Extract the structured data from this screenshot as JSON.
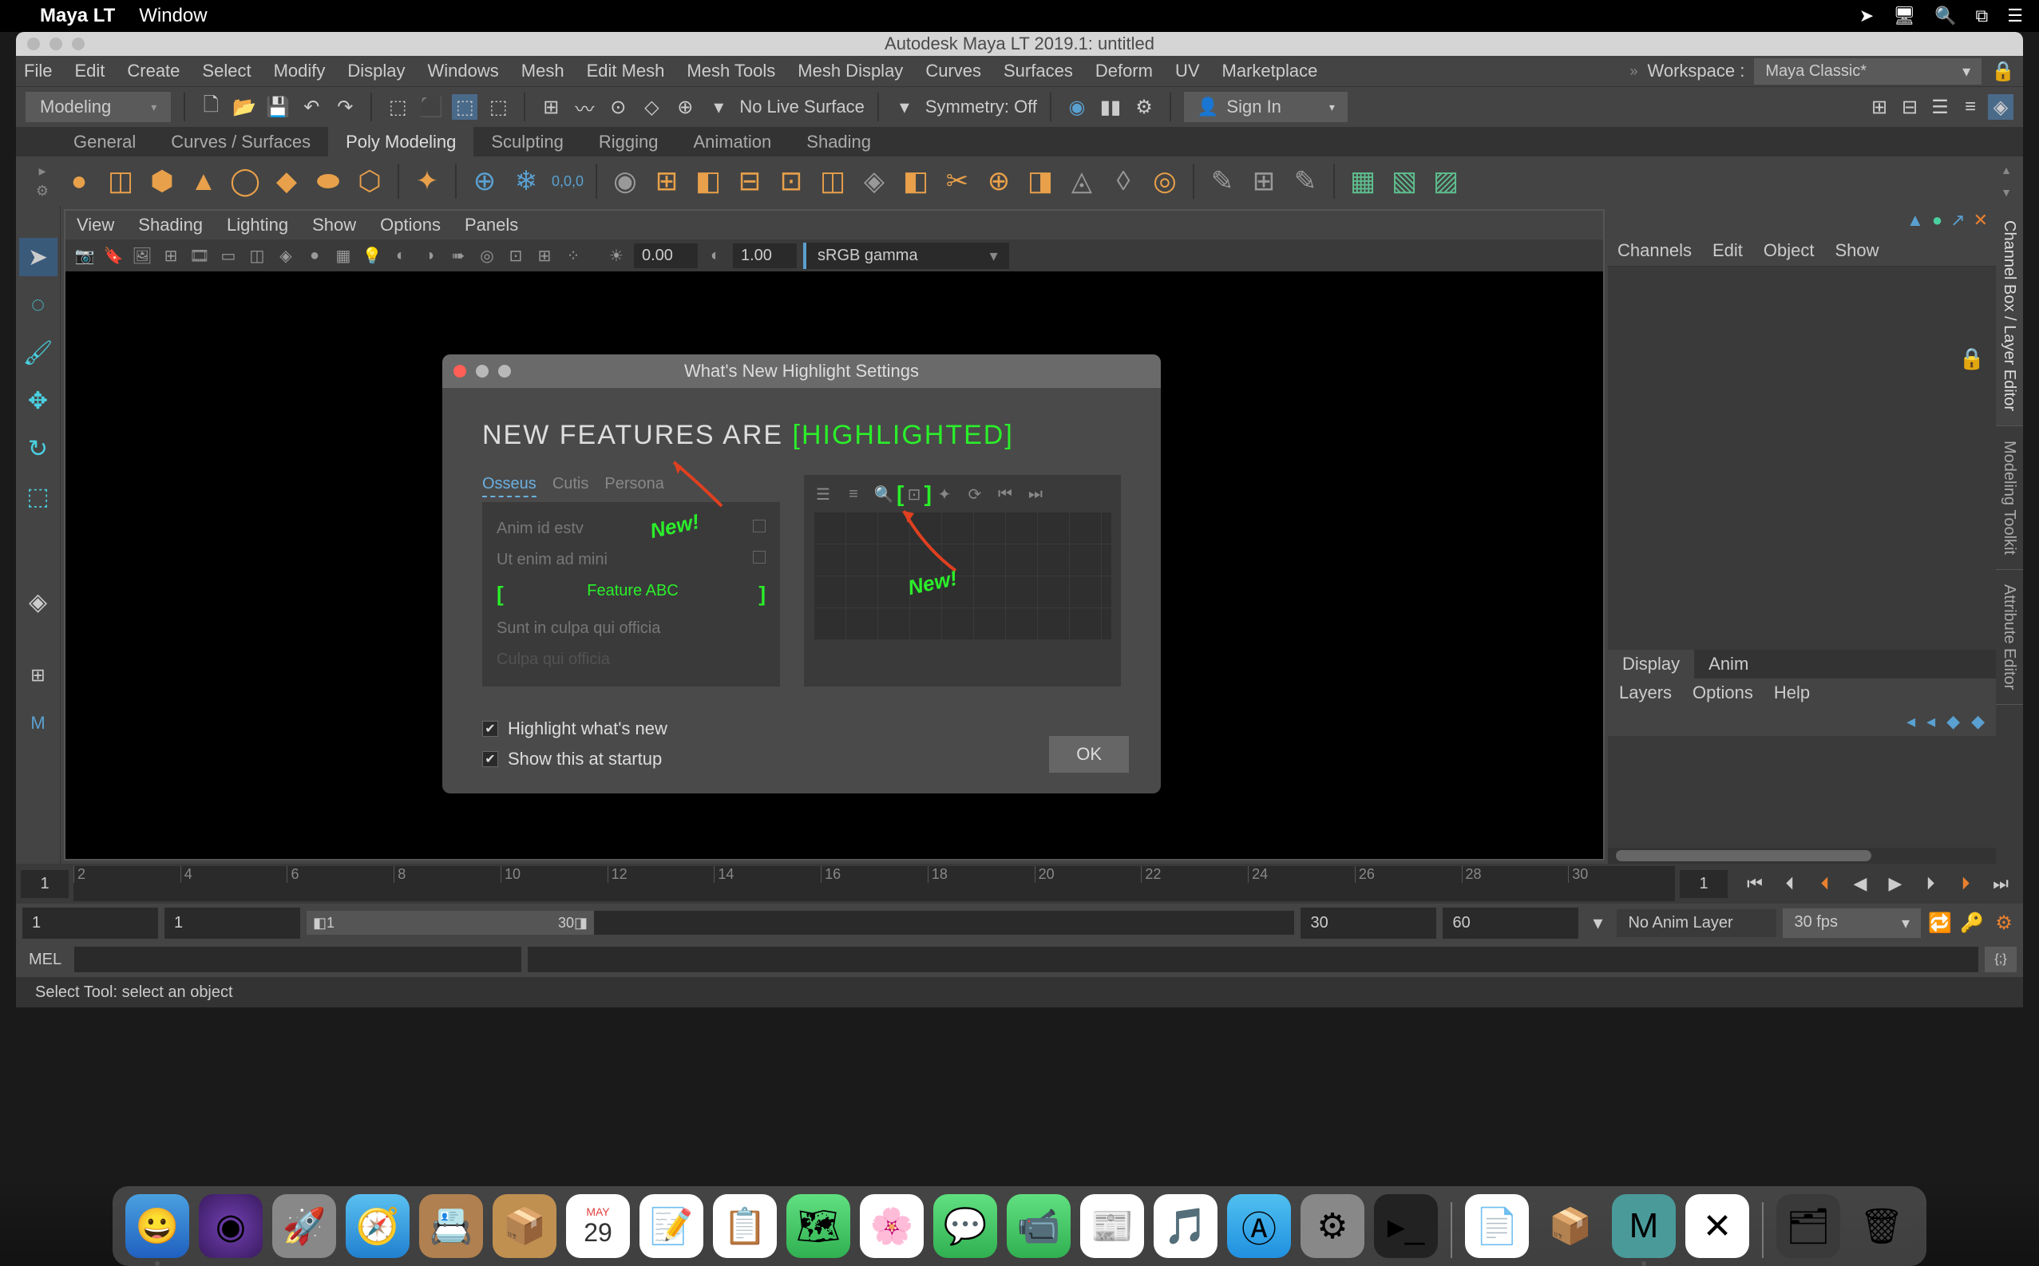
{
  "mac_menu": {
    "app": "Maya LT",
    "items": [
      "Window"
    ]
  },
  "window_title": "Autodesk Maya LT 2019.1: untitled",
  "main_menu": [
    "File",
    "Edit",
    "Create",
    "Select",
    "Modify",
    "Display",
    "Windows",
    "Mesh",
    "Edit Mesh",
    "Mesh Tools",
    "Mesh Display",
    "Curves",
    "Surfaces",
    "Deform",
    "UV",
    "Marketplace"
  ],
  "workspace": {
    "label": "Workspace :",
    "value": "Maya Classic*"
  },
  "status_line": {
    "mode": "Modeling",
    "live_surface": "No Live Surface",
    "symmetry": "Symmetry: Off",
    "signin": "Sign In"
  },
  "shelf_tabs": [
    "General",
    "Curves / Surfaces",
    "Poly Modeling",
    "Sculpting",
    "Rigging",
    "Animation",
    "Shading"
  ],
  "shelf_active": "Poly Modeling",
  "panel_menu": [
    "View",
    "Shading",
    "Lighting",
    "Show",
    "Options",
    "Panels"
  ],
  "panel_toolbar": {
    "val1": "0.00",
    "val2": "1.00",
    "cm": "sRGB gamma"
  },
  "channel_tabs": [
    "Channels",
    "Edit",
    "Object",
    "Show"
  ],
  "display_tabs": [
    "Display",
    "Anim"
  ],
  "layers_menu": [
    "Layers",
    "Options",
    "Help"
  ],
  "side_tabs": [
    "Channel Box / Layer Editor",
    "Modeling Toolkit",
    "Attribute Editor"
  ],
  "timeline": {
    "current": "1",
    "ticks": [
      "2",
      "4",
      "6",
      "8",
      "10",
      "12",
      "14",
      "16",
      "18",
      "20",
      "22",
      "24",
      "26",
      "28",
      "30"
    ],
    "end_field": "1"
  },
  "range": {
    "start": "1",
    "range_start": "1",
    "slider_start": "1",
    "slider_end": "30",
    "range_end": "30",
    "end": "60",
    "anim_layer": "No Anim Layer",
    "fps": "30 fps"
  },
  "cmd": {
    "label": "MEL"
  },
  "help": "Select Tool: select an object",
  "dialog": {
    "title": "What's New Highlight Settings",
    "heading_a": "NEW FEATURES ARE ",
    "heading_b": "[HIGHLIGHTED]",
    "tabs": [
      "Osseus",
      "Cutis",
      "Persona"
    ],
    "items": [
      "Anim id estv",
      "Ut enim ad mini",
      "Feature ABC",
      "Sunt in culpa qui officia",
      "Culpa qui officia"
    ],
    "new_label": "New!",
    "check1": "Highlight what's new",
    "check2": "Show this at startup",
    "ok": "OK"
  },
  "dock_date": {
    "month": "MAY",
    "day": "29"
  }
}
